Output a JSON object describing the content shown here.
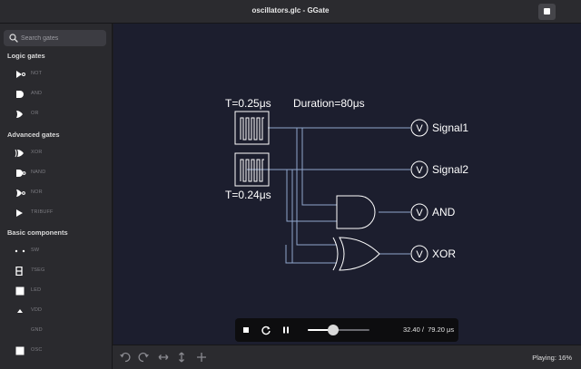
{
  "window": {
    "title": "oscillators.glc - GGate"
  },
  "search": {
    "placeholder": "Search gates"
  },
  "sidebar": {
    "groups": [
      {
        "title": "Logic gates",
        "items": [
          {
            "label": "NOT",
            "icon": "not-gate-icon"
          },
          {
            "label": "AND",
            "icon": "and-gate-icon"
          },
          {
            "label": "OR",
            "icon": "or-gate-icon"
          }
        ]
      },
      {
        "title": "Advanced gates",
        "items": [
          {
            "label": "XOR",
            "icon": "xor-gate-icon"
          },
          {
            "label": "NAND",
            "icon": "nand-gate-icon"
          },
          {
            "label": "NOR",
            "icon": "nor-gate-icon"
          },
          {
            "label": "TRIBUFF",
            "icon": "tribuff-icon"
          }
        ]
      },
      {
        "title": "Basic components",
        "items": [
          {
            "label": "SW",
            "icon": "switch-icon"
          },
          {
            "label": "7SEG",
            "icon": "seven-segment-icon"
          },
          {
            "label": "LED",
            "icon": "led-icon"
          },
          {
            "label": "VDD",
            "icon": "vdd-icon"
          },
          {
            "label": "GND",
            "icon": "gnd-icon"
          },
          {
            "label": "OSC",
            "icon": "osc-icon"
          }
        ]
      }
    ]
  },
  "circuit": {
    "osc1_label": "T=0.25μs",
    "osc2_label": "T=0.24μs",
    "duration_label": "Duration=80μs",
    "probe_symbol": "V",
    "outputs": [
      "Signal1",
      "Signal2",
      "AND",
      "XOR"
    ]
  },
  "player": {
    "current": "32.40",
    "separator": "/",
    "total": "79.20 μs",
    "progress": 0.41
  },
  "status": {
    "text": "Playing: 16%"
  },
  "colors": {
    "canvas": "#1c1e2e",
    "wire": "#8fa6cc",
    "component": "#ffffff",
    "player": "#0d0d0f"
  }
}
